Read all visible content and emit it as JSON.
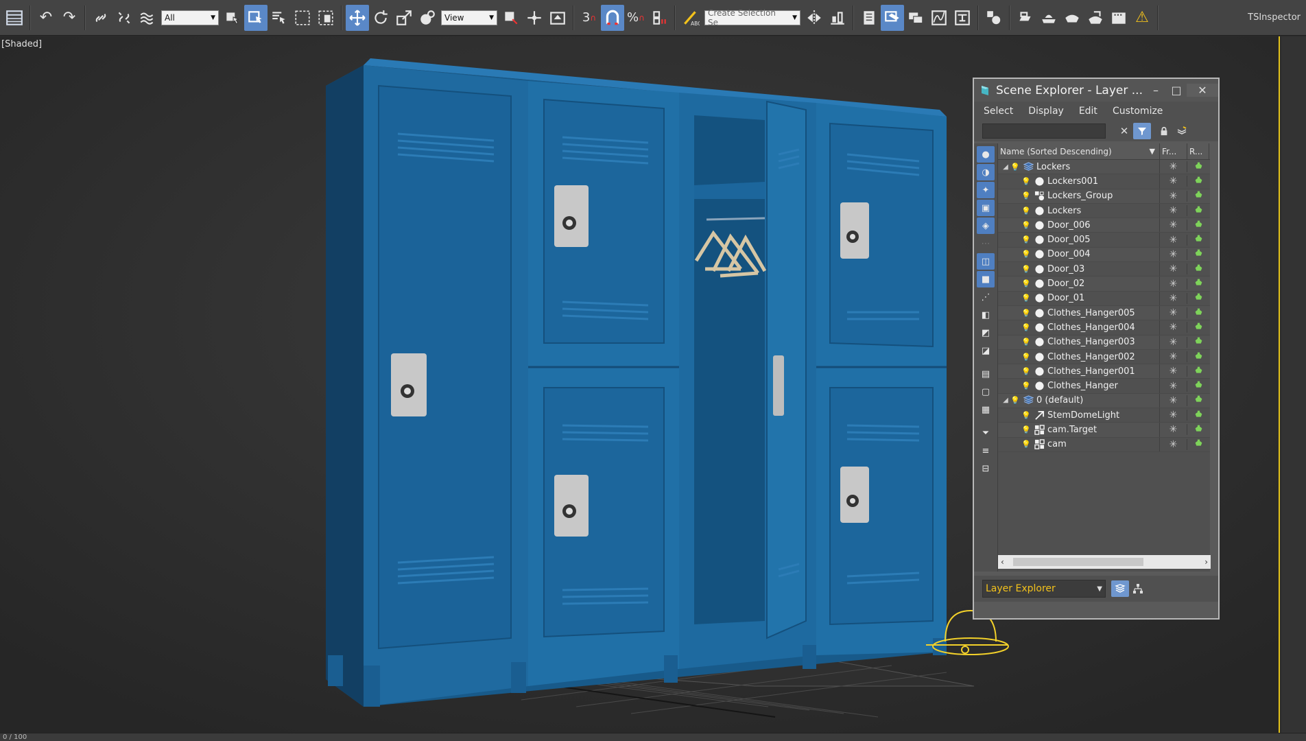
{
  "toolbar": {
    "selection_filter": "All",
    "ref_coord": "View",
    "snap_label": "3",
    "named_selection_placeholder": "Create Selection Se",
    "ts_inspector": "TSInspector"
  },
  "viewport": {
    "label": "[Shaded]",
    "accent_color": "#e3c21a",
    "locker_color": "#1f6aa0"
  },
  "explorer": {
    "title": "Scene Explorer - Layer ...",
    "menu": [
      "Select",
      "Display",
      "Edit",
      "Customize"
    ],
    "search_value": "",
    "columns": {
      "name": "Name (Sorted Descending)",
      "frozen": "Fr...",
      "render": "R..."
    },
    "rows": [
      {
        "label": "Lockers",
        "level": 0,
        "type": "layer",
        "expanded": true
      },
      {
        "label": "Lockers001",
        "level": 1,
        "type": "geometry"
      },
      {
        "label": "Lockers_Group",
        "level": 1,
        "type": "group"
      },
      {
        "label": "Lockers",
        "level": 1,
        "type": "geometry"
      },
      {
        "label": "Door_006",
        "level": 1,
        "type": "geometry"
      },
      {
        "label": "Door_005",
        "level": 1,
        "type": "geometry"
      },
      {
        "label": "Door_004",
        "level": 1,
        "type": "geometry"
      },
      {
        "label": "Door_03",
        "level": 1,
        "type": "geometry"
      },
      {
        "label": "Door_02",
        "level": 1,
        "type": "geometry"
      },
      {
        "label": "Door_01",
        "level": 1,
        "type": "geometry"
      },
      {
        "label": "Clothes_Hanger005",
        "level": 1,
        "type": "geometry"
      },
      {
        "label": "Clothes_Hanger004",
        "level": 1,
        "type": "geometry"
      },
      {
        "label": "Clothes_Hanger003",
        "level": 1,
        "type": "geometry"
      },
      {
        "label": "Clothes_Hanger002",
        "level": 1,
        "type": "geometry"
      },
      {
        "label": "Clothes_Hanger001",
        "level": 1,
        "type": "geometry"
      },
      {
        "label": "Clothes_Hanger",
        "level": 1,
        "type": "geometry"
      },
      {
        "label": "0 (default)",
        "level": 0,
        "type": "layer",
        "expanded": true
      },
      {
        "label": "StemDomeLight",
        "level": 1,
        "type": "light"
      },
      {
        "label": "cam.Target",
        "level": 1,
        "type": "camera"
      },
      {
        "label": "cam",
        "level": 1,
        "type": "camera"
      }
    ],
    "footer_combo": "Layer Explorer"
  },
  "status": {
    "frame_counter": "0 / 100"
  }
}
